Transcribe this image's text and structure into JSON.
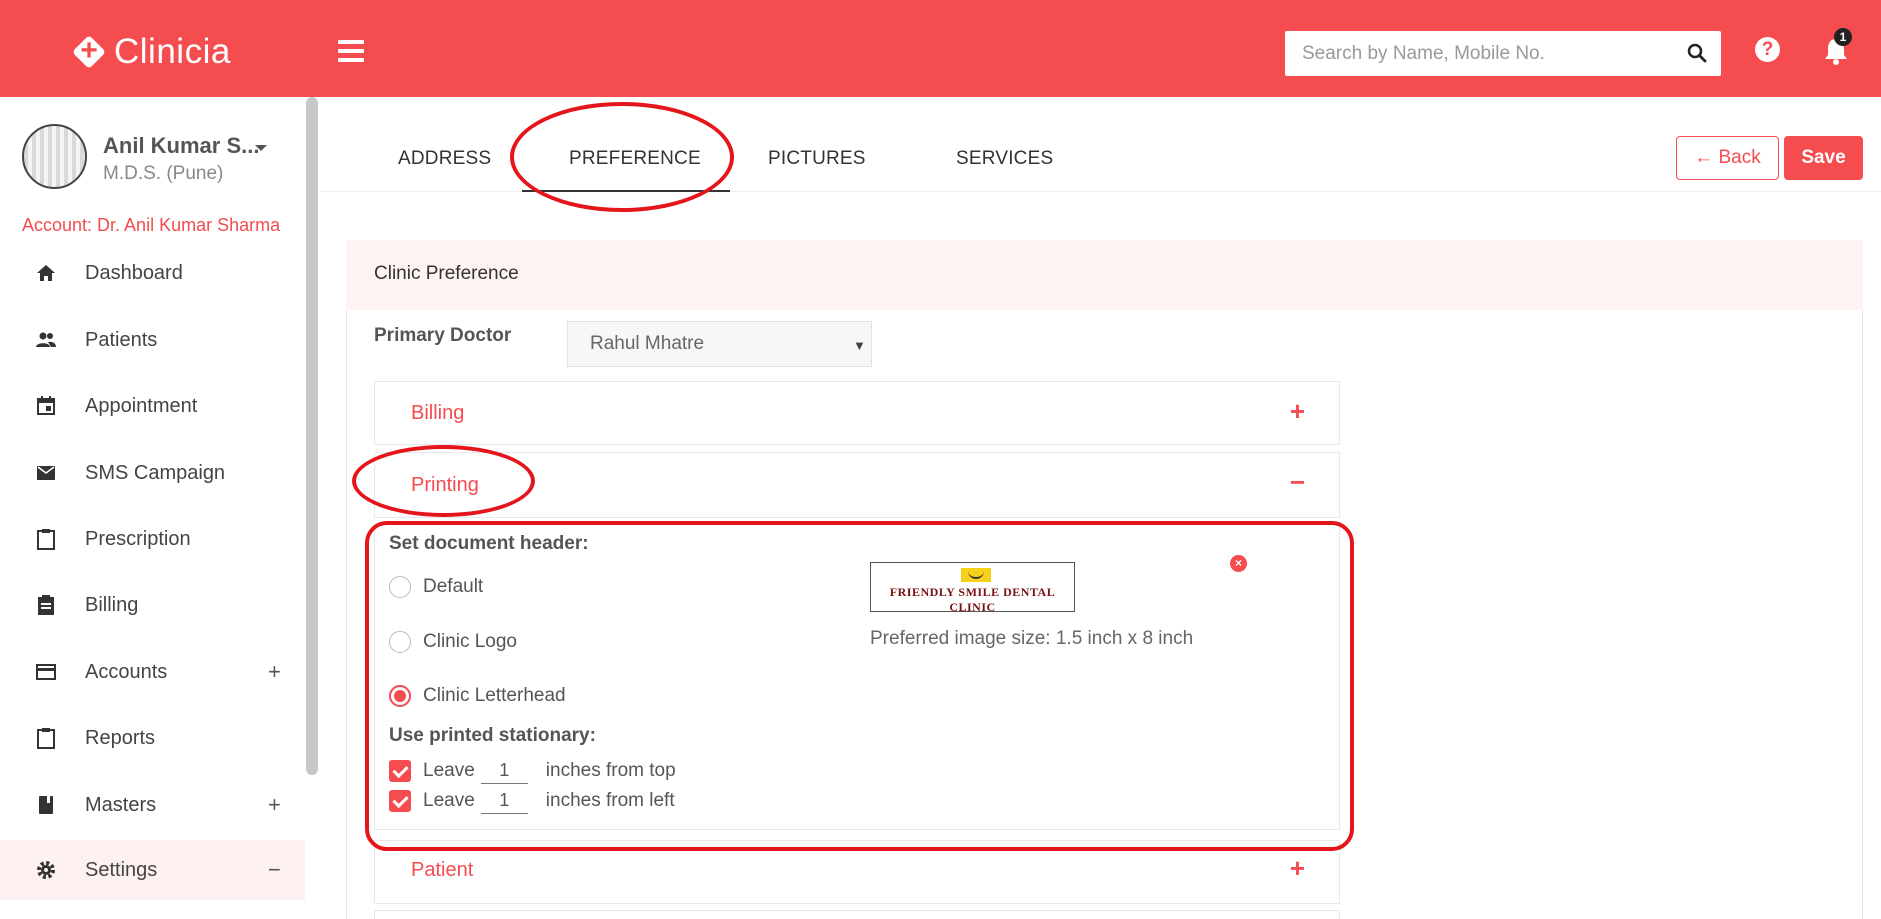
{
  "app": {
    "name": "Clinicia"
  },
  "header": {
    "search_placeholder": "Search by Name, Mobile No.",
    "help_label": "?",
    "notifications_count": "1"
  },
  "profile": {
    "name": "Anil Kumar S...",
    "degree": "M.D.S. (Pune)",
    "account": "Account: Dr. Anil Kumar Sharma"
  },
  "sidebar": {
    "items": [
      {
        "label": "Dashboard",
        "icon": "home-icon"
      },
      {
        "label": "Patients",
        "icon": "people-icon"
      },
      {
        "label": "Appointment",
        "icon": "calendar-icon"
      },
      {
        "label": "SMS Campaign",
        "icon": "mail-icon"
      },
      {
        "label": "Prescription",
        "icon": "clipboard-icon"
      },
      {
        "label": "Billing",
        "icon": "receipt-icon"
      },
      {
        "label": "Accounts",
        "icon": "card-icon",
        "toggle": "+"
      },
      {
        "label": "Reports",
        "icon": "clipboard-icon"
      },
      {
        "label": "Masters",
        "icon": "book-icon",
        "toggle": "+"
      },
      {
        "label": "Settings",
        "icon": "gear-icon",
        "toggle": "−"
      }
    ]
  },
  "tabs": [
    {
      "label": "ADDRESS"
    },
    {
      "label": "PREFERENCE",
      "active": true
    },
    {
      "label": "PICTURES"
    },
    {
      "label": "SERVICES"
    }
  ],
  "actions": {
    "back_label": "← Back",
    "save_label": "Save"
  },
  "panel": {
    "title": "Clinic Preference",
    "primary_doctor_label": "Primary Doctor",
    "primary_doctor_value": "Rahul Mhatre"
  },
  "sections": {
    "billing": {
      "title": "Billing",
      "sign": "+"
    },
    "printing": {
      "title": "Printing",
      "sign": "−"
    },
    "patient": {
      "title": "Patient",
      "sign": "+"
    }
  },
  "printing": {
    "header_label": "Set document header:",
    "options": [
      {
        "label": "Default",
        "checked": false
      },
      {
        "label": "Clinic Logo",
        "checked": false
      },
      {
        "label": "Clinic Letterhead",
        "checked": true
      }
    ],
    "stationary_label": "Use printed stationary:",
    "leave_text": "Leave",
    "top": {
      "value": "1",
      "suffix": "inches from top",
      "checked": true
    },
    "left": {
      "value": "1",
      "suffix": "inches from left",
      "checked": true
    },
    "letterhead_text": "FRIENDLY SMILE DENTAL CLINIC",
    "preferred_size": "Preferred image size: 1.5 inch x 8 inch"
  },
  "colors": {
    "brand": "#f44c4f",
    "annotation": "#e4151b"
  }
}
